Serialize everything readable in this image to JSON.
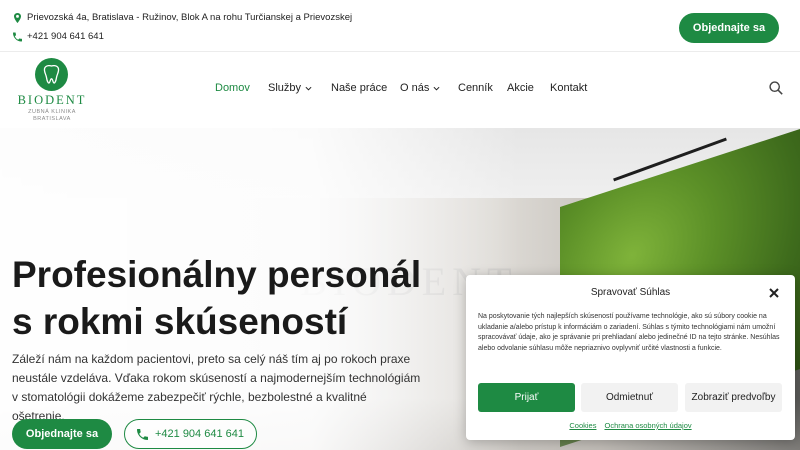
{
  "topbar": {
    "address": "Prievozská 4a, Bratislava - Ružinov, Blok A na rohu Turčianskej a Prievozskej",
    "phone": "+421 904 641 641",
    "cta_label": "Objednajte sa"
  },
  "logo": {
    "name": "BIODENT",
    "sub_line1": "ZUBNÁ KLINIKA",
    "sub_line2": "BRATISLAVA"
  },
  "nav": {
    "items": [
      {
        "label": "Domov",
        "active": true
      },
      {
        "label": "Služby",
        "dropdown": true
      },
      {
        "label": "Naše práce"
      },
      {
        "label": "O nás",
        "dropdown": true
      },
      {
        "label": "Cenník"
      },
      {
        "label": "Akcie"
      },
      {
        "label": "Kontakt"
      }
    ],
    "search_icon": "search-icon"
  },
  "hero": {
    "title_line1": "Profesionálny personál",
    "title_line2": "s rokmi skúseností",
    "text": "Záleží nám na každom pacientovi, preto sa celý náš tím aj po rokoch praxe neustále vzdeláva. Vďaka rokom skúseností a najmodernejším technológiám v stomatológii dokážeme zabezpečiť rýchle, bezbolestné a kvalitné ošetrenie.",
    "cta_label": "Objednajte sa",
    "phone_label": "+421 904 641 641"
  },
  "cookie": {
    "title": "Spravovať Súhlas",
    "text": "Na poskytovanie tých najlepších skúseností používame technológie, ako sú súbory cookie na ukladanie a/alebo prístup k informáciám o zariadení. Súhlas s týmito technológiami nám umožní spracovávať údaje, ako je správanie pri prehliadaní alebo jedinečné ID na tejto stránke. Nesúhlas alebo odvolanie súhlasu môže nepriaznivo ovplyvniť určité vlastnosti a funkcie.",
    "accept_label": "Prijať",
    "deny_label": "Odmietnuť",
    "prefs_label": "Zobraziť predvoľby",
    "link_cookies": "Cookies",
    "link_privacy": "Ochrana osobných údajov"
  },
  "colors": {
    "brand_green": "#1e8a43"
  }
}
